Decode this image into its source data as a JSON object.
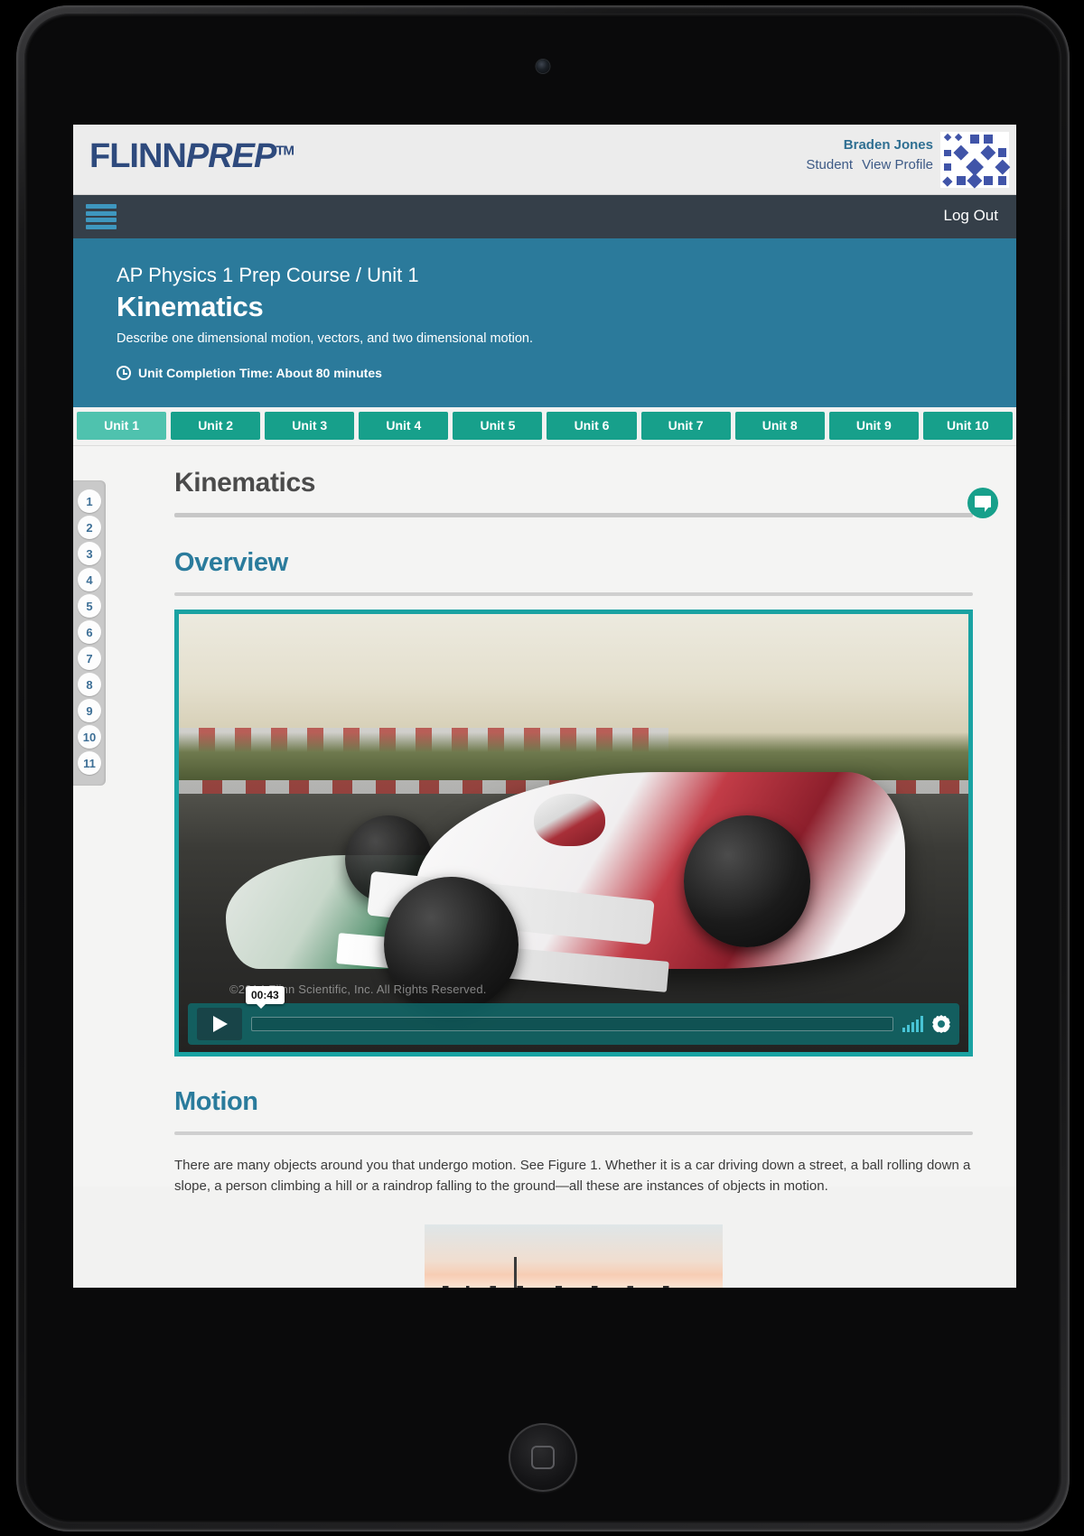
{
  "brand": {
    "logo_main": "FLINN",
    "logo_accent": "PREP",
    "logo_tm": "TM",
    "logo_color": "#2e4a7d"
  },
  "header": {
    "user_name": "Braden Jones",
    "user_role": "Student",
    "view_profile_label": "View Profile",
    "avatar_name": "identicon-avatar"
  },
  "navbar": {
    "menu_label": "menu",
    "logout_label": "Log Out",
    "background": "#353f49",
    "hamburger_color": "#3e97bf"
  },
  "course": {
    "breadcrumb": "AP Physics 1 Prep Course / Unit 1",
    "title": "Kinematics",
    "description": "Describe one dimensional motion, vectors, and two dimensional motion.",
    "completion_time": "Unit Completion Time: About 80 minutes",
    "banner_color": "#2b7a9b"
  },
  "unit_tabs": {
    "active_index": 0,
    "active_color": "#4fc2ae",
    "inactive_color": "#17a08b",
    "items": [
      {
        "label": "Unit 1"
      },
      {
        "label": "Unit 2"
      },
      {
        "label": "Unit 3"
      },
      {
        "label": "Unit 4"
      },
      {
        "label": "Unit 5"
      },
      {
        "label": "Unit 6"
      },
      {
        "label": "Unit 7"
      },
      {
        "label": "Unit 8"
      },
      {
        "label": "Unit 9"
      },
      {
        "label": "Unit 10"
      }
    ]
  },
  "page_rail": {
    "items": [
      "1",
      "2",
      "3",
      "4",
      "5",
      "6",
      "7",
      "8",
      "9",
      "10",
      "11"
    ]
  },
  "content": {
    "page_heading": "Kinematics",
    "chat_icon_name": "chat-bubble-icon",
    "sections": [
      {
        "heading": "Overview"
      },
      {
        "heading": "Motion"
      }
    ],
    "motion_paragraph": "There are many objects around you that undergo motion. See Figure 1. Whether it is a car driving down a street, a ball rolling down a slope, a person climbing a hill or a raindrop falling to the ground—all these are instances of objects in motion."
  },
  "video": {
    "copyright_overlay": "©2014 Flinn Scientific, Inc. All Rights Reserved.",
    "current_time": "00:43",
    "play_label": "Play",
    "volume_label": "Volume",
    "settings_label": "Settings",
    "border_color": "#19a2a2",
    "poster_description": "Formula race cars on a track at sunset"
  },
  "figure": {
    "caption": "",
    "description": "City skyline at sunset"
  }
}
